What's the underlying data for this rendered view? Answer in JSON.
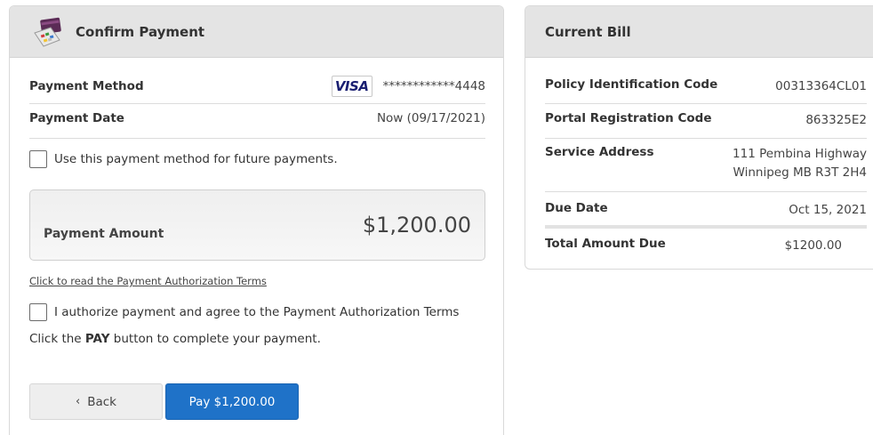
{
  "confirm": {
    "title": "Confirm Payment",
    "payment_method_label": "Payment Method",
    "card_brand": "VISA",
    "card_number": "************4448",
    "payment_date_label": "Payment Date",
    "payment_date_value": "Now (09/17/2021)",
    "future_payments_label": "Use this payment method for future payments.",
    "amount_label": "Payment Amount",
    "amount_value": "$1,200.00",
    "terms_link": "Click to read the Payment Authorization Terms",
    "authorize_label": "I authorize payment and agree to the Payment Authorization Terms",
    "instruction_prefix": "Click the ",
    "instruction_bold": "PAY",
    "instruction_suffix": " button to complete your payment.",
    "back_label": "Back",
    "pay_label": "Pay $1,200.00"
  },
  "bill": {
    "title": "Current Bill",
    "rows": [
      {
        "label": "Policy Identification Code",
        "value": "00313364CL01"
      },
      {
        "label": "Portal Registration Code",
        "value": "863325E2"
      },
      {
        "label": "Service Address",
        "value_line1": "111 Pembina Highway",
        "value_line2": "Winnipeg MB R3T 2H4"
      },
      {
        "label": "Due Date",
        "value": "Oct 15, 2021"
      },
      {
        "label": "Total Amount Due",
        "value": "$1200.00"
      }
    ]
  },
  "colors": {
    "header_bg": "#e4e4e4",
    "pay_button": "#1f72c8",
    "visa_blue": "#1a1f71"
  },
  "icons": {
    "header_icon": "payment-terminal-icon",
    "back_chevron": "chevron-left-icon"
  }
}
